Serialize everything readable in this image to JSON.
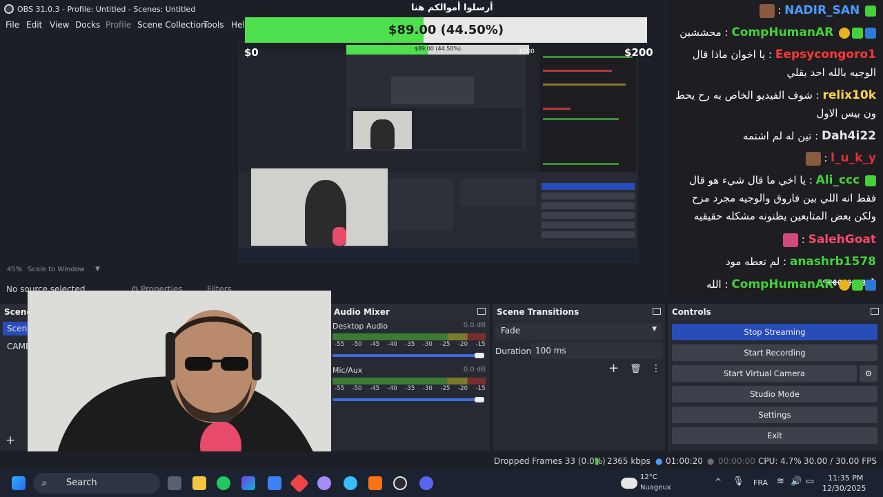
{
  "window": {
    "title": "OBS 31.0.3 - Profile: Untitled - Scenes: Untitled",
    "min_glyph": "—",
    "max_glyph": "☐",
    "close_glyph": "✕"
  },
  "menu": [
    "File",
    "Edit",
    "View",
    "Docks",
    "Profile",
    "Scene Collection",
    "Tools",
    "Help"
  ],
  "donation": {
    "title": "أرسلوا أموالكم هنا",
    "amount_text": "$89.00 (44.50%)",
    "progress_percent": 44.5,
    "min_label": "$0",
    "max_label": "$200",
    "nested_amount_text": "$89.00 (44.50%)",
    "nested_min": "$0",
    "nested_max": "$200"
  },
  "preview": {
    "zoom": "45%",
    "scale_mode": "Scale to Window"
  },
  "source_bar": {
    "no_source": "No source selected",
    "properties": "Properties",
    "filters": "Filters"
  },
  "chat": [
    {
      "user": "NADIR_SAN",
      "text": "",
      "color": "#4a9bff",
      "badges": [
        "diamond"
      ],
      "emote": true
    },
    {
      "user": "CompHumanAR",
      "text": "محششين",
      "color": "#44d13a",
      "badges": [
        "prime",
        "diamond",
        "gift"
      ]
    },
    {
      "user": "Eepsycongoro1",
      "text": "يا اخوان ماذا قال الوجيه بالله احد يقلي",
      "color": "#ff3838",
      "badges": []
    },
    {
      "user": "relix10k",
      "text": "شوف الفيديو الخاص به رح يحط ون بيس الاول",
      "color": "#ffd54a",
      "badges": []
    },
    {
      "user": "Dah4i22",
      "text": "تين له لم اشتمه",
      "color": "#e6e6e6",
      "badges": []
    },
    {
      "user": "l_u_k_y",
      "text": "",
      "color": "#e62e3b",
      "badges": [],
      "emote": true
    },
    {
      "user": "Ali_ccc",
      "text": "يا اخي ما قال شيء هو قال فقط انه اللي بين فاروق والوجيه مجرد مزح ولكن بعض المتابعين يظنونه مشكله حقيقيه",
      "color": "#44d13a",
      "badges": [
        "diamond"
      ]
    },
    {
      "user": "SalehGoat",
      "text": "",
      "color": "#ff4a6b",
      "badges": [],
      "emote": true
    },
    {
      "user": "anashrb1578",
      "text": "لم تعطه مود ههههههههههه",
      "color": "#44d13a",
      "badges": []
    },
    {
      "user": "CompHumanAR",
      "text": "الله اكبرررررر",
      "color": "#44d13a",
      "badges": [
        "prime",
        "diamond",
        "gift"
      ]
    }
  ],
  "docks": {
    "scenes": {
      "title": "Scenes",
      "items": [
        "Scene",
        "CAMERA"
      ]
    },
    "mixer": {
      "title": "Audio Mixer",
      "tracks": [
        {
          "name": "Desktop Audio",
          "db": "0.0 dB",
          "level": 0.88
        },
        {
          "name": "Mic/Aux",
          "db": "0.0 dB",
          "level": 0.88
        }
      ],
      "ticks": "-55 -50 -45 -40 -35 -30 -25 -20 -15 -10 -5 0"
    },
    "transitions": {
      "title": "Scene Transitions",
      "selected": "Fade",
      "duration_label": "Duration",
      "duration_value": "100 ms"
    },
    "controls": {
      "title": "Controls",
      "buttons": [
        "Stop Streaming",
        "Start Recording",
        "Start Virtual Camera",
        "Studio Mode",
        "Settings",
        "Exit"
      ]
    }
  },
  "status": {
    "dropped": "Dropped Frames 33 (0.0%)",
    "bitrate": "2365 kbps",
    "live_time": "01:00:20",
    "rec_time": "00:00:00",
    "cpu": "CPU: 4.7%",
    "fps": "30.00 / 30.00 FPS"
  },
  "taskbar": {
    "search": "Search",
    "weather_temp": "12°C",
    "weather_desc": "Nuageux",
    "lang": "FRA",
    "time": "11:35 PM",
    "date": "12/30/2025"
  },
  "colors": {
    "accent": "#284cb8",
    "progress_green": "#4ee04e",
    "panel": "#272a33",
    "background": "#1d1f26"
  }
}
